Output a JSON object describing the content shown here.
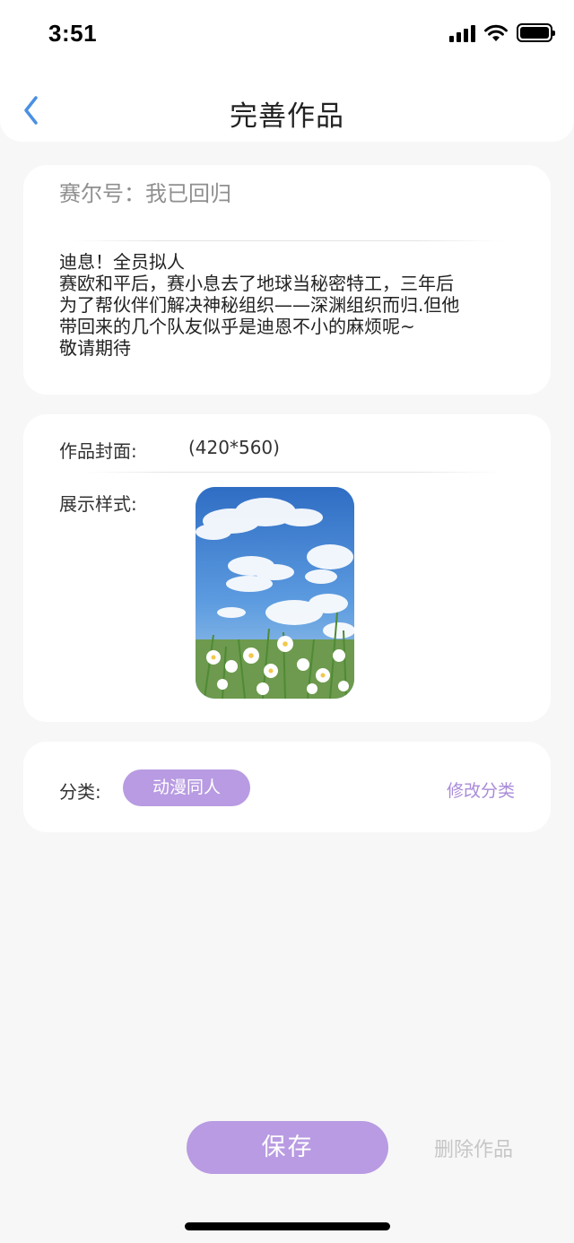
{
  "status_bar": {
    "time": "3:51"
  },
  "header": {
    "title": "完善作品"
  },
  "work": {
    "title": "赛尔号：我已回归",
    "description_lines": [
      "迪息！全员拟人",
      "赛欧和平后，赛小息去了地球当秘密特工，三年后",
      "为了帮伙伴们解决神秘组织——深渊组织而归.但他",
      "带回来的几个队友似乎是迪恩不小的麻烦呢~",
      "敬请期待"
    ]
  },
  "cover": {
    "label": "作品封面:",
    "size_hint": "(420*560)",
    "style_label": "展示样式:"
  },
  "category": {
    "label": "分类:",
    "value": "动漫同人",
    "edit_label": "修改分类"
  },
  "actions": {
    "save_label": "保存",
    "delete_label": "删除作品"
  },
  "colors": {
    "accent": "#b89be2",
    "accent_text": "#a98bd8",
    "back_arrow": "#4a90e2",
    "background": "#f7f7f7"
  }
}
